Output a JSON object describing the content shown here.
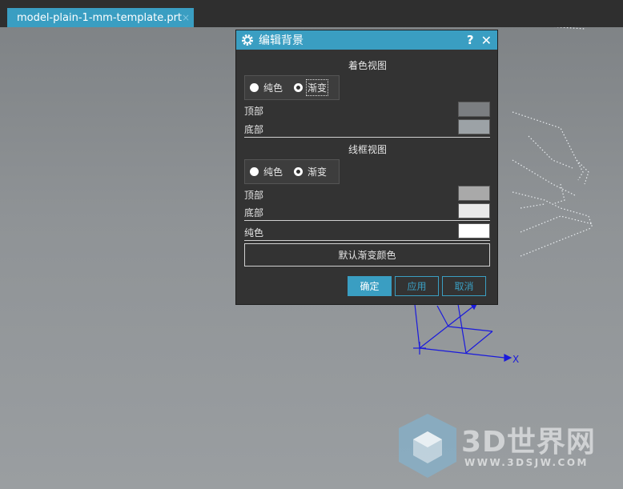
{
  "tab": {
    "title": "model-plain-1-mm-template.prt",
    "close_glyph": "×",
    "icon": "part-file-icon"
  },
  "dialog": {
    "title": "编辑背景",
    "help_label": "?",
    "close_label": "✕",
    "shaded": {
      "section_title": "着色视图",
      "radio_solid": "纯色",
      "radio_gradient": "渐变",
      "selected": "渐变",
      "top_label": "顶部",
      "bottom_label": "底部",
      "top_color": "#7b7e81",
      "bottom_color": "#9ca2a6"
    },
    "wireframe": {
      "section_title": "线框视图",
      "radio_solid": "纯色",
      "radio_gradient": "渐变",
      "selected": "渐变",
      "top_label": "顶部",
      "bottom_label": "底部",
      "top_color": "#a9a9a9",
      "bottom_color": "#e8e8e8"
    },
    "solid": {
      "label": "纯色",
      "color": "#ffffff"
    },
    "default_gradient_label": "默认渐变颜色",
    "ok_label": "确定",
    "apply_label": "应用",
    "cancel_label": "取消"
  },
  "viewport": {
    "axis_x_label": "X",
    "axis_color": "#1a1adc"
  },
  "watermark": {
    "brand": "3D世界网",
    "url": "WWW.3DSJW.COM"
  }
}
